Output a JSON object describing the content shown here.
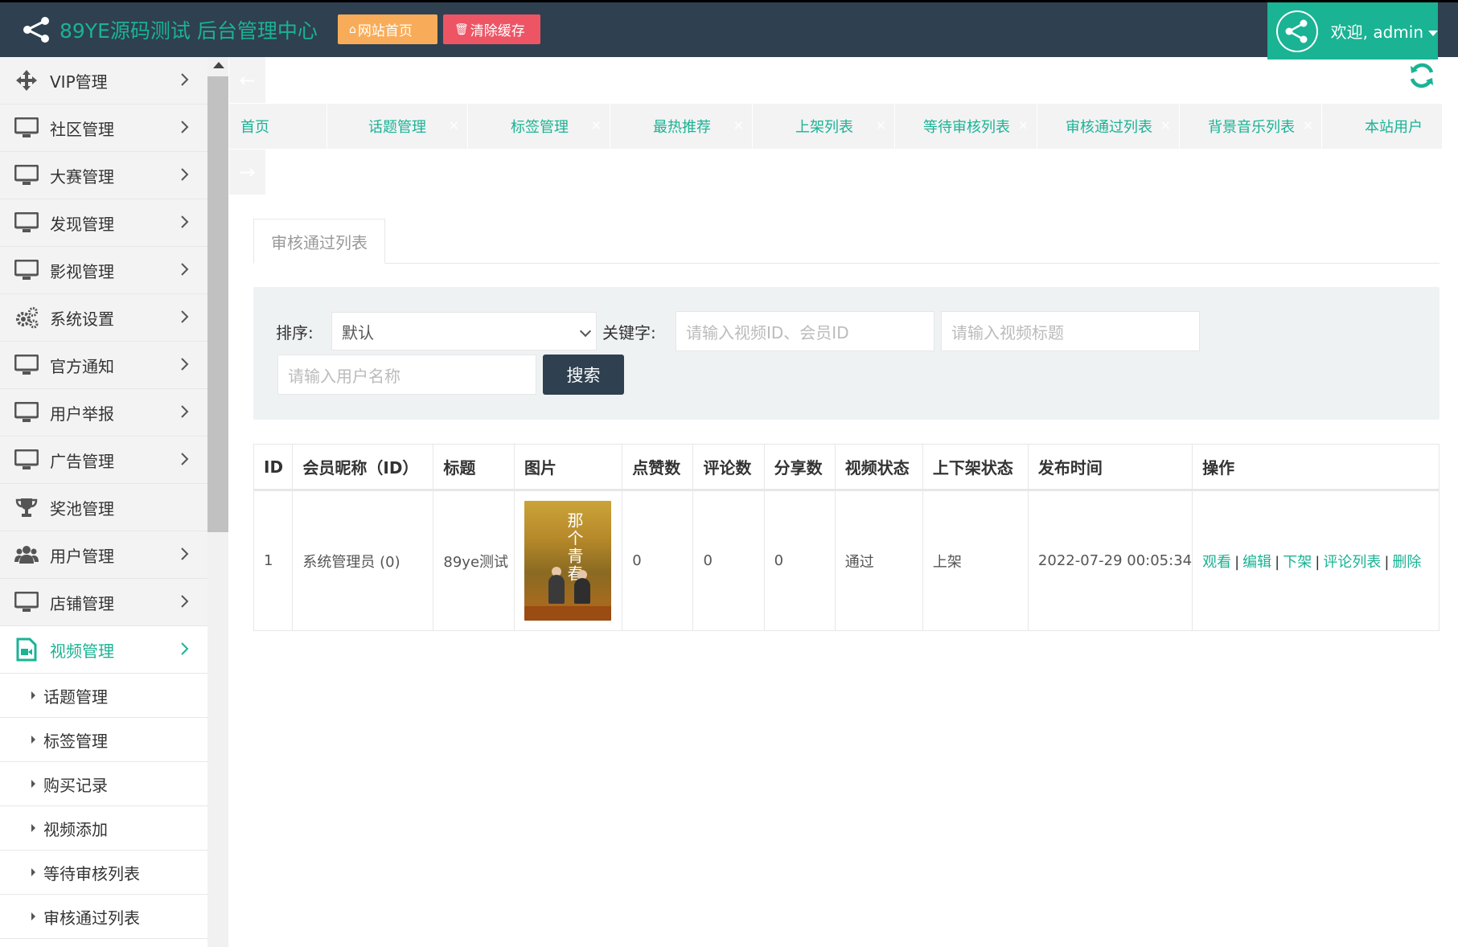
{
  "header": {
    "brand_title": "89YE源码测试 后台管理中心",
    "home_button": "网站首页",
    "clear_cache_button": "清除缓存",
    "welcome": "欢迎, admin",
    "colors": {
      "bar": "#2f4050",
      "accent": "#1ab394",
      "home": "#f8ac59",
      "clear": "#ed5565"
    }
  },
  "sidebar": {
    "items": [
      {
        "label": "VIP管理",
        "icon": "move-arrows-icon"
      },
      {
        "label": "社区管理",
        "icon": "monitor-icon"
      },
      {
        "label": "大赛管理",
        "icon": "monitor-icon"
      },
      {
        "label": "发现管理",
        "icon": "monitor-icon"
      },
      {
        "label": "影视管理",
        "icon": "monitor-icon"
      },
      {
        "label": "系统设置",
        "icon": "gears-icon"
      },
      {
        "label": "官方通知",
        "icon": "monitor-icon"
      },
      {
        "label": "用户举报",
        "icon": "monitor-icon"
      },
      {
        "label": "广告管理",
        "icon": "monitor-icon"
      },
      {
        "label": "奖池管理",
        "icon": "trophy-icon"
      },
      {
        "label": "用户管理",
        "icon": "users-icon"
      },
      {
        "label": "店铺管理",
        "icon": "monitor-icon"
      },
      {
        "label": "视频管理",
        "icon": "video-file-icon"
      }
    ],
    "subitems": [
      "话题管理",
      "标签管理",
      "购买记录",
      "视频添加",
      "等待审核列表",
      "审核通过列表"
    ]
  },
  "tabs": [
    "首页",
    "话题管理",
    "标签管理",
    "最热推荐",
    "上架列表",
    "等待审核列表",
    "审核通过列表",
    "背景音乐列表",
    "本站用户"
  ],
  "content": {
    "tab_label": "审核通过列表",
    "sort_label": "排序:",
    "sort_value": "默认",
    "keyword_label": "关键字:",
    "ph_video_id": "请输入视频ID、会员ID",
    "ph_video_title": "请输入视频标题",
    "ph_user_name": "请输入用户名称",
    "search_button": "搜索"
  },
  "table": {
    "headers": [
      "ID",
      "会员昵称（ID）",
      "标题",
      "图片",
      "点赞数",
      "评论数",
      "分享数",
      "视频状态",
      "上下架状态",
      "发布时间",
      "操作"
    ],
    "rows": [
      {
        "id": "1",
        "member": "系统管理员 (0)",
        "title": "89ye测试",
        "image_text": "那个青春",
        "likes": "0",
        "comments": "0",
        "shares": "0",
        "video_status": "通过",
        "shelf_status": "上架",
        "publish_time": "2022-07-29 00:05:34",
        "ops": [
          "观看",
          "编辑",
          "下架",
          "评论列表",
          "删除"
        ]
      }
    ]
  }
}
